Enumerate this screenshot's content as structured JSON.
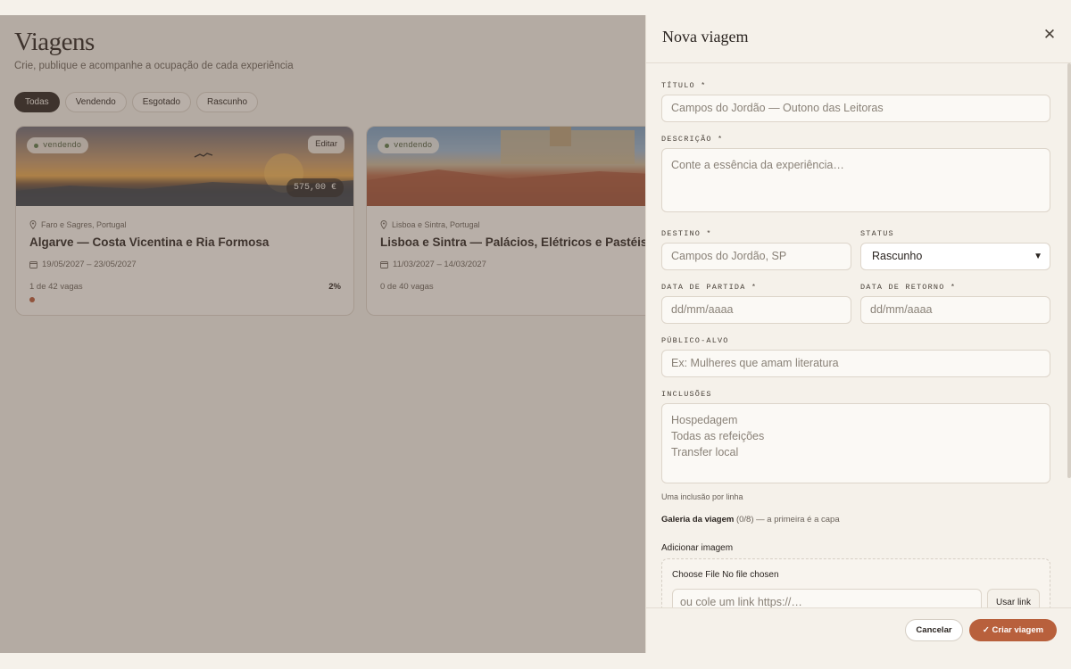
{
  "page": {
    "title": "Viagens",
    "subtitle": "Crie, publique e acompanhe a ocupação de cada experiência",
    "filters": [
      "Todas",
      "Vendendo",
      "Esgotado",
      "Rascunho"
    ],
    "active_filter": "Todas"
  },
  "cards": [
    {
      "status": "vendendo",
      "edit_label": "Editar",
      "price": "575,00 €",
      "location": "Faro e Sagres, Portugal",
      "title": "Algarve — Costa Vicentina e Ria Formosa",
      "dates": "19/05/2027 – 23/05/2027",
      "vagas": "1 de 42 vagas",
      "percent": "2%"
    },
    {
      "status": "vendendo",
      "location": "Lisboa e Sintra, Portugal",
      "title": "Lisboa e Sintra — Palácios, Elétricos e Pastéis",
      "dates": "11/03/2027 – 14/03/2027",
      "vagas": "0 de 40 vagas"
    }
  ],
  "drawer": {
    "title": "Nova viagem",
    "titulo_label": "TÍTULO *",
    "titulo_placeholder": "Campos do Jordão — Outono das Leitoras",
    "descricao_label": "DESCRIÇÃO *",
    "descricao_placeholder": "Conte a essência da experiência…",
    "destino_label": "DESTINO *",
    "destino_placeholder": "Campos do Jordão, SP",
    "status_label": "STATUS",
    "status_value": "Rascunho",
    "partida_label": "DATA DE PARTIDA *",
    "partida_placeholder": "dd/mm/aaaa",
    "retorno_label": "DATA DE RETORNO *",
    "retorno_placeholder": "dd/mm/aaaa",
    "publico_label": "PÚBLICO-ALVO",
    "publico_placeholder": "Ex: Mulheres que amam literatura",
    "inclusoes_label": "INCLUSÕES",
    "inclusoes_lines": [
      "Hospedagem",
      "Todas as refeições",
      "Transfer local"
    ],
    "inclusoes_hint": "Uma inclusão por linha",
    "galeria_label": "Galeria da viagem",
    "galeria_count": "(0/8) — a primeira é a capa",
    "add_image_label": "Adicionar imagem",
    "file_input_text": "Choose File No file chosen",
    "url_placeholder": "ou cole um link https://…",
    "use_link_label": "Usar link",
    "cancel_label": "Cancelar",
    "create_label": "Criar viagem"
  },
  "colors": {
    "accent": "#b8603c",
    "dark": "#2a2420",
    "background": "#f5f1ea",
    "status_green": "#5a7a4a"
  }
}
